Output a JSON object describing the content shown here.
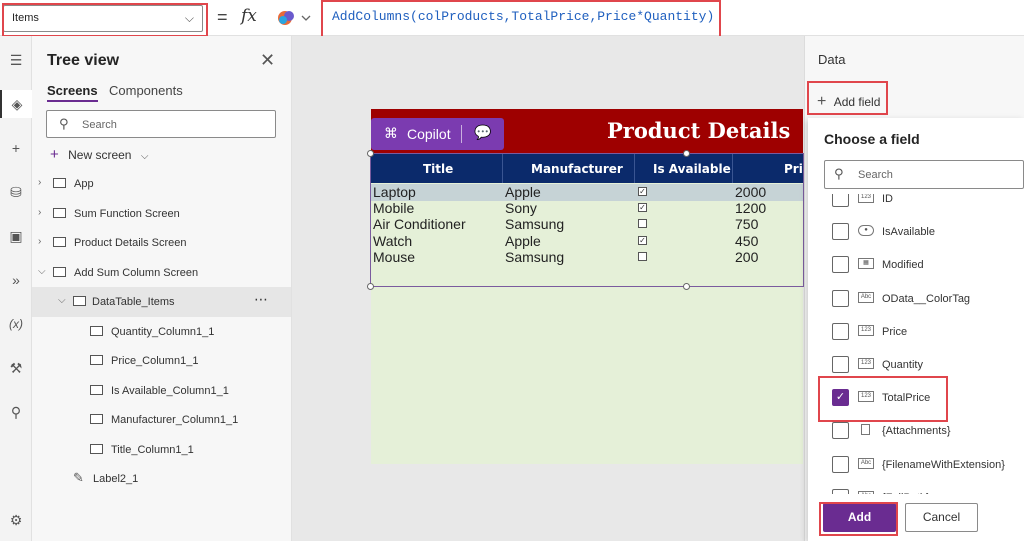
{
  "formula_bar": {
    "property": "Items",
    "equals": "=",
    "fx": "fx",
    "formula": "AddColumns(colProducts,TotalPrice,Price*Quantity)"
  },
  "tree_view": {
    "title": "Tree view",
    "tabs": [
      "Screens",
      "Components"
    ],
    "search_placeholder": "Search",
    "new_screen": "New screen",
    "items": [
      {
        "label": "App"
      },
      {
        "label": "Sum Function Screen"
      },
      {
        "label": "Product Details Screen"
      },
      {
        "label": "Add Sum Column Screen"
      },
      {
        "label": "DataTable_Items"
      },
      {
        "label": "Quantity_Column1_1"
      },
      {
        "label": "Price_Column1_1"
      },
      {
        "label": "Is Available_Column1_1"
      },
      {
        "label": "Manufacturer_Column1_1"
      },
      {
        "label": "Title_Column1_1"
      },
      {
        "label": "Label2_1"
      }
    ]
  },
  "canvas": {
    "page_title": "Product Details",
    "copilot_label": "Copilot",
    "columns": [
      "Title",
      "Manufacturer",
      "Is Available",
      "Pri"
    ],
    "rows": [
      {
        "title": "Laptop",
        "manufacturer": "Apple",
        "available": true,
        "price": "2000"
      },
      {
        "title": "Mobile",
        "manufacturer": "Sony",
        "available": true,
        "price": "1200"
      },
      {
        "title": "Air Conditioner",
        "manufacturer": "Samsung",
        "available": false,
        "price": "750"
      },
      {
        "title": "Watch",
        "manufacturer": "Apple",
        "available": true,
        "price": "450"
      },
      {
        "title": "Mouse",
        "manufacturer": "Samsung",
        "available": false,
        "price": "200"
      }
    ]
  },
  "data_panel": {
    "title": "Data",
    "add_field": "Add field",
    "choose_title": "Choose a field",
    "search_placeholder": "Search",
    "fields": [
      {
        "label": "ID",
        "type": "123",
        "checked": false
      },
      {
        "label": "IsAvailable",
        "type": "toggle",
        "checked": false
      },
      {
        "label": "Modified",
        "type": "date",
        "checked": false
      },
      {
        "label": "OData__ColorTag",
        "type": "Abc",
        "checked": false
      },
      {
        "label": "Price",
        "type": "123",
        "checked": false
      },
      {
        "label": "Quantity",
        "type": "123",
        "checked": false
      },
      {
        "label": "TotalPrice",
        "type": "123",
        "checked": true
      },
      {
        "label": "{Attachments}",
        "type": "file",
        "checked": false
      },
      {
        "label": "{FilenameWithExtension}",
        "type": "Abc",
        "checked": false
      },
      {
        "label": "{FullPath}",
        "type": "Abc",
        "checked": false
      }
    ],
    "add_button": "Add",
    "cancel_button": "Cancel"
  },
  "colors": {
    "accent": "#6a2c91",
    "header_red": "#9e0000",
    "table_header": "#0b2a6b",
    "canvas_bg": "#e5f0d8",
    "highlight_border": "#e0464c"
  }
}
